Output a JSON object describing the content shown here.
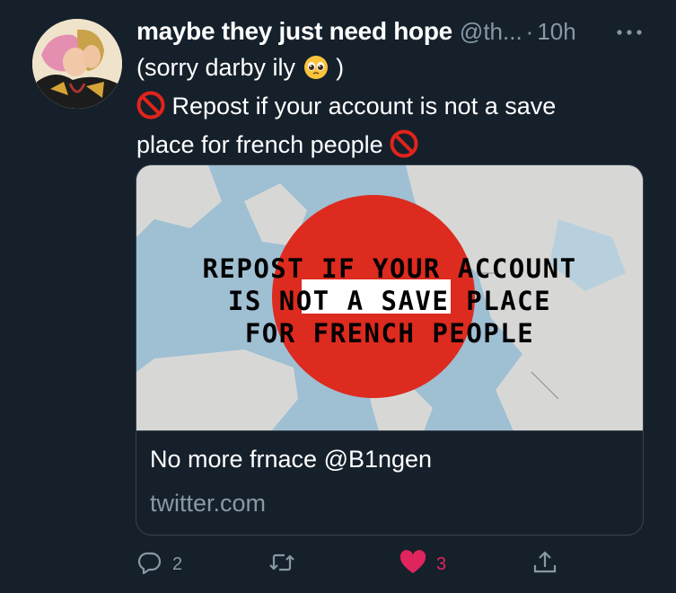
{
  "tweet": {
    "display_name": "maybe they just need hope",
    "handle": "@th...",
    "separator": "·",
    "time": "10h",
    "text_lines": [
      "(sorry darby ily",
      "Repost if your account is not a save",
      "place for french people"
    ],
    "text_close_paren": ")"
  },
  "card": {
    "image_text_lines": [
      "REPOST IF YOUR ACCOUNT",
      "IS NOT A SAVE PLACE",
      "FOR FRENCH PEOPLE"
    ],
    "title": "No more frnace @B1ngen",
    "domain": "twitter.com"
  },
  "actions": {
    "reply_count": "2",
    "retweet_count": "",
    "like_count": "3"
  },
  "icons": {
    "more": "more-horizontal-icon",
    "reply": "speech-bubble-icon",
    "retweet": "retweet-arrows-icon",
    "like": "heart-icon",
    "share": "share-up-arrow-icon",
    "no_entry": "prohibited-emoji",
    "pleading": "pleading-face-emoji"
  },
  "colors": {
    "background": "#15202b",
    "secondary_text": "#8899a6",
    "border": "#38444d",
    "like": "#e0245e",
    "sign_red": "#dd2b1f"
  }
}
